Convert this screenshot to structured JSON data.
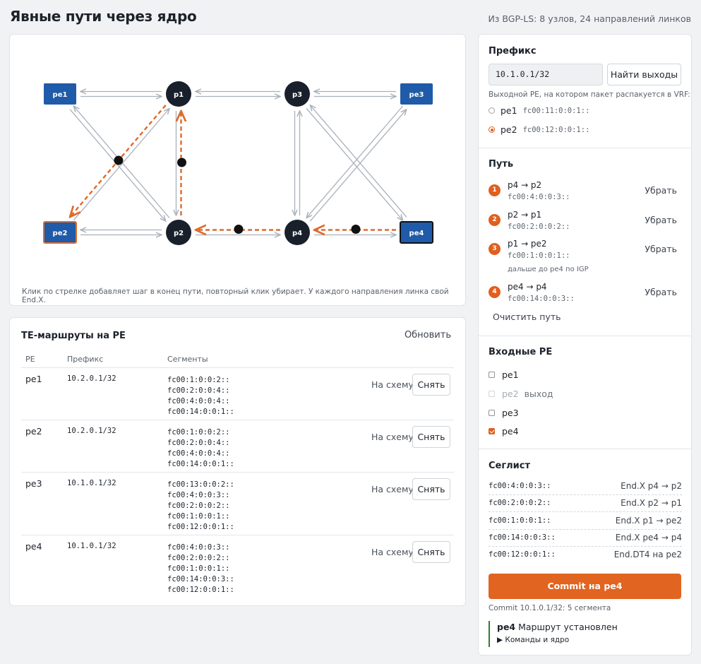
{
  "page": {
    "title": "Явные пути через ядро",
    "subtitle": "Из BGP-LS: 8 узлов, 24 направлений линков"
  },
  "graph": {
    "nodes": {
      "pe1": "pe1",
      "p1": "p1",
      "p3": "p3",
      "pe3": "pe3",
      "pe2": "pe2",
      "p2": "p2",
      "p4": "p4",
      "pe4": "pe4"
    },
    "colors": {
      "pe": "#1f5ba8",
      "p": "#19202b",
      "path": "#e06a2b",
      "link": "#a9b1bb",
      "selected_border": "#e06a2b"
    },
    "hint": "Клик по стрелке добавляет шаг в конец пути, повторный клик убирает. У каждого направления линка свой End.X."
  },
  "routes": {
    "title": "TE-маршруты на PE",
    "refresh_label": "Обновить",
    "headers": {
      "pe": "PE",
      "prefix": "Префикс",
      "segments": "Сегменты"
    },
    "show_label": "На схему",
    "remove_label": "Снять",
    "rows": [
      {
        "pe": "pe1",
        "prefix": "10.2.0.1/32",
        "segments": [
          "fc00:1:0:0:2::",
          "fc00:2:0:0:4::",
          "fc00:4:0:0:4::",
          "fc00:14:0:0:1::"
        ]
      },
      {
        "pe": "pe2",
        "prefix": "10.2.0.1/32",
        "segments": [
          "fc00:1:0:0:2::",
          "fc00:2:0:0:4::",
          "fc00:4:0:0:4::",
          "fc00:14:0:0:1::"
        ]
      },
      {
        "pe": "pe3",
        "prefix": "10.1.0.1/32",
        "segments": [
          "fc00:13:0:0:2::",
          "fc00:4:0:0:3::",
          "fc00:2:0:0:2::",
          "fc00:1:0:0:1::",
          "fc00:12:0:0:1::"
        ]
      },
      {
        "pe": "pe4",
        "prefix": "10.1.0.1/32",
        "segments": [
          "fc00:4:0:0:3::",
          "fc00:2:0:0:2::",
          "fc00:1:0:0:1::",
          "fc00:14:0:0:3::",
          "fc00:12:0:0:1::"
        ]
      }
    ]
  },
  "prefix": {
    "title": "Префикс",
    "value": "10.1.0.1/32",
    "find_button": "Найти выходы",
    "exit_hint": "Выходной PE, на котором пакет распакуется в VRF:",
    "exits": [
      {
        "pe": "pe1",
        "addr": "fc00:11:0:0:1::",
        "selected": false
      },
      {
        "pe": "pe2",
        "addr": "fc00:12:0:0:1::",
        "selected": true
      }
    ]
  },
  "path": {
    "title": "Путь",
    "remove_label": "Убрать",
    "steps": [
      {
        "num": "1",
        "hop": "p4 → p2",
        "sid": "fc00:4:0:0:3::"
      },
      {
        "num": "2",
        "hop": "p2 → p1",
        "sid": "fc00:2:0:0:2::"
      },
      {
        "num": "3",
        "hop": "p1 → pe2",
        "sid": "fc00:1:0:0:1::",
        "note": "дальше до pe4 по IGP"
      },
      {
        "num": "4",
        "hop": "pe4 → p4",
        "sid": "fc00:14:0:0:3::"
      }
    ],
    "clear_label": "Очистить путь"
  },
  "ingress": {
    "title": "Входные PE",
    "items": [
      {
        "pe": "pe1",
        "checked": false,
        "disabled": false,
        "tag": ""
      },
      {
        "pe": "pe2",
        "checked": false,
        "disabled": true,
        "tag": "выход"
      },
      {
        "pe": "pe3",
        "checked": false,
        "disabled": false,
        "tag": ""
      },
      {
        "pe": "pe4",
        "checked": true,
        "disabled": false,
        "tag": ""
      }
    ]
  },
  "seglist": {
    "title": "Сеглист",
    "rows": [
      {
        "sid": "fc00:4:0:0:3::",
        "fn": "End.X p4 → p2"
      },
      {
        "sid": "fc00:2:0:0:2::",
        "fn": "End.X p2 → p1"
      },
      {
        "sid": "fc00:1:0:0:1::",
        "fn": "End.X p1 → pe2"
      },
      {
        "sid": "fc00:14:0:0:3::",
        "fn": "End.X pe4 → p4"
      },
      {
        "sid": "fc00:12:0:0:1::",
        "fn": "End.DT4 на pe2"
      }
    ]
  },
  "commit": {
    "button": "Commit на pe4",
    "note": "Commit 10.1.0.1/32: 5 сегмента",
    "status_pe": "pe4",
    "status_text": "Маршрут установлен",
    "details": "Команды и ядро"
  }
}
